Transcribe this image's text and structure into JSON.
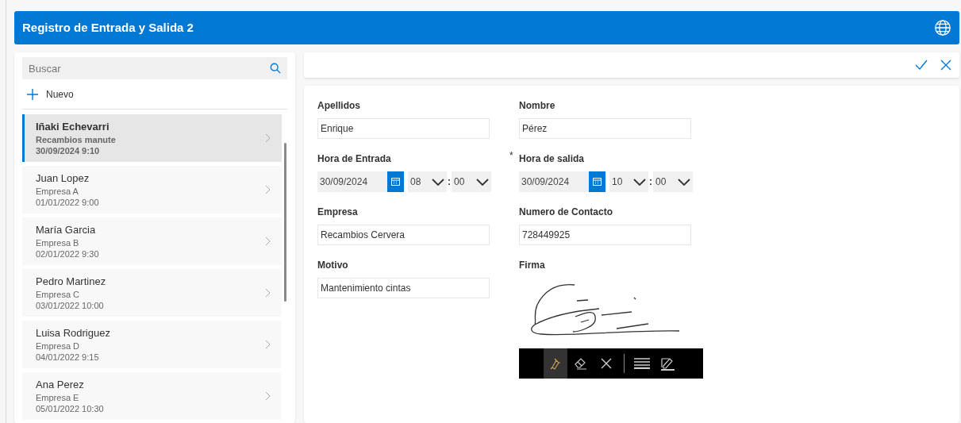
{
  "header": {
    "title": "Registro de Entrada y Salida 2"
  },
  "sidebar": {
    "search": {
      "placeholder": "Buscar"
    },
    "new_button": {
      "label": "Nuevo"
    },
    "records": [
      {
        "name": "Iñaki Echevarri",
        "company": "Recambios manute",
        "datetime": "30/09/2024 9:10",
        "selected": true
      },
      {
        "name": "Juan Lopez",
        "company": "Empresa A",
        "datetime": "01/01/2022 9:00",
        "selected": false
      },
      {
        "name": "María Garcia",
        "company": "Empresa B",
        "datetime": "02/01/2022 9:30",
        "selected": false
      },
      {
        "name": "Pedro Martinez",
        "company": "Empresa C",
        "datetime": "03/01/2022 10:00",
        "selected": false
      },
      {
        "name": "Luisa Rodriguez",
        "company": "Empresa D",
        "datetime": "04/01/2022 9:15",
        "selected": false
      },
      {
        "name": "Ana Perez",
        "company": "Empresa E",
        "datetime": "05/01/2022 10:30",
        "selected": false
      }
    ]
  },
  "form": {
    "fields": [
      {
        "kind": "text",
        "label": "Apellidos",
        "value": "Enrique"
      },
      {
        "kind": "text",
        "label": "Nombre",
        "value": "Pérez"
      },
      {
        "kind": "datetime",
        "label": "Hora de Entrada",
        "date": "30/09/2024",
        "hour": "08",
        "separator": ":",
        "minute": "00"
      },
      {
        "kind": "datetime",
        "label": "Hora de salida",
        "date": "30/09/2024",
        "hour": "10",
        "separator": ":",
        "minute": "00",
        "required_mark": "*"
      },
      {
        "kind": "text",
        "label": "Empresa",
        "value": "Recambios Cervera"
      },
      {
        "kind": "text",
        "label": "Numero de Contacto",
        "value": "728449925"
      },
      {
        "kind": "text",
        "label": "Motivo",
        "value": "Mantenimiento cintas"
      },
      {
        "kind": "signature",
        "label": "Firma",
        "tools": [
          {
            "kind": "pen",
            "selected": true
          },
          {
            "kind": "eraser",
            "selected": false
          },
          {
            "kind": "clear",
            "selected": false
          },
          {
            "kind": "thickness",
            "selected": false
          },
          {
            "kind": "edit",
            "selected": false
          }
        ]
      }
    ]
  }
}
